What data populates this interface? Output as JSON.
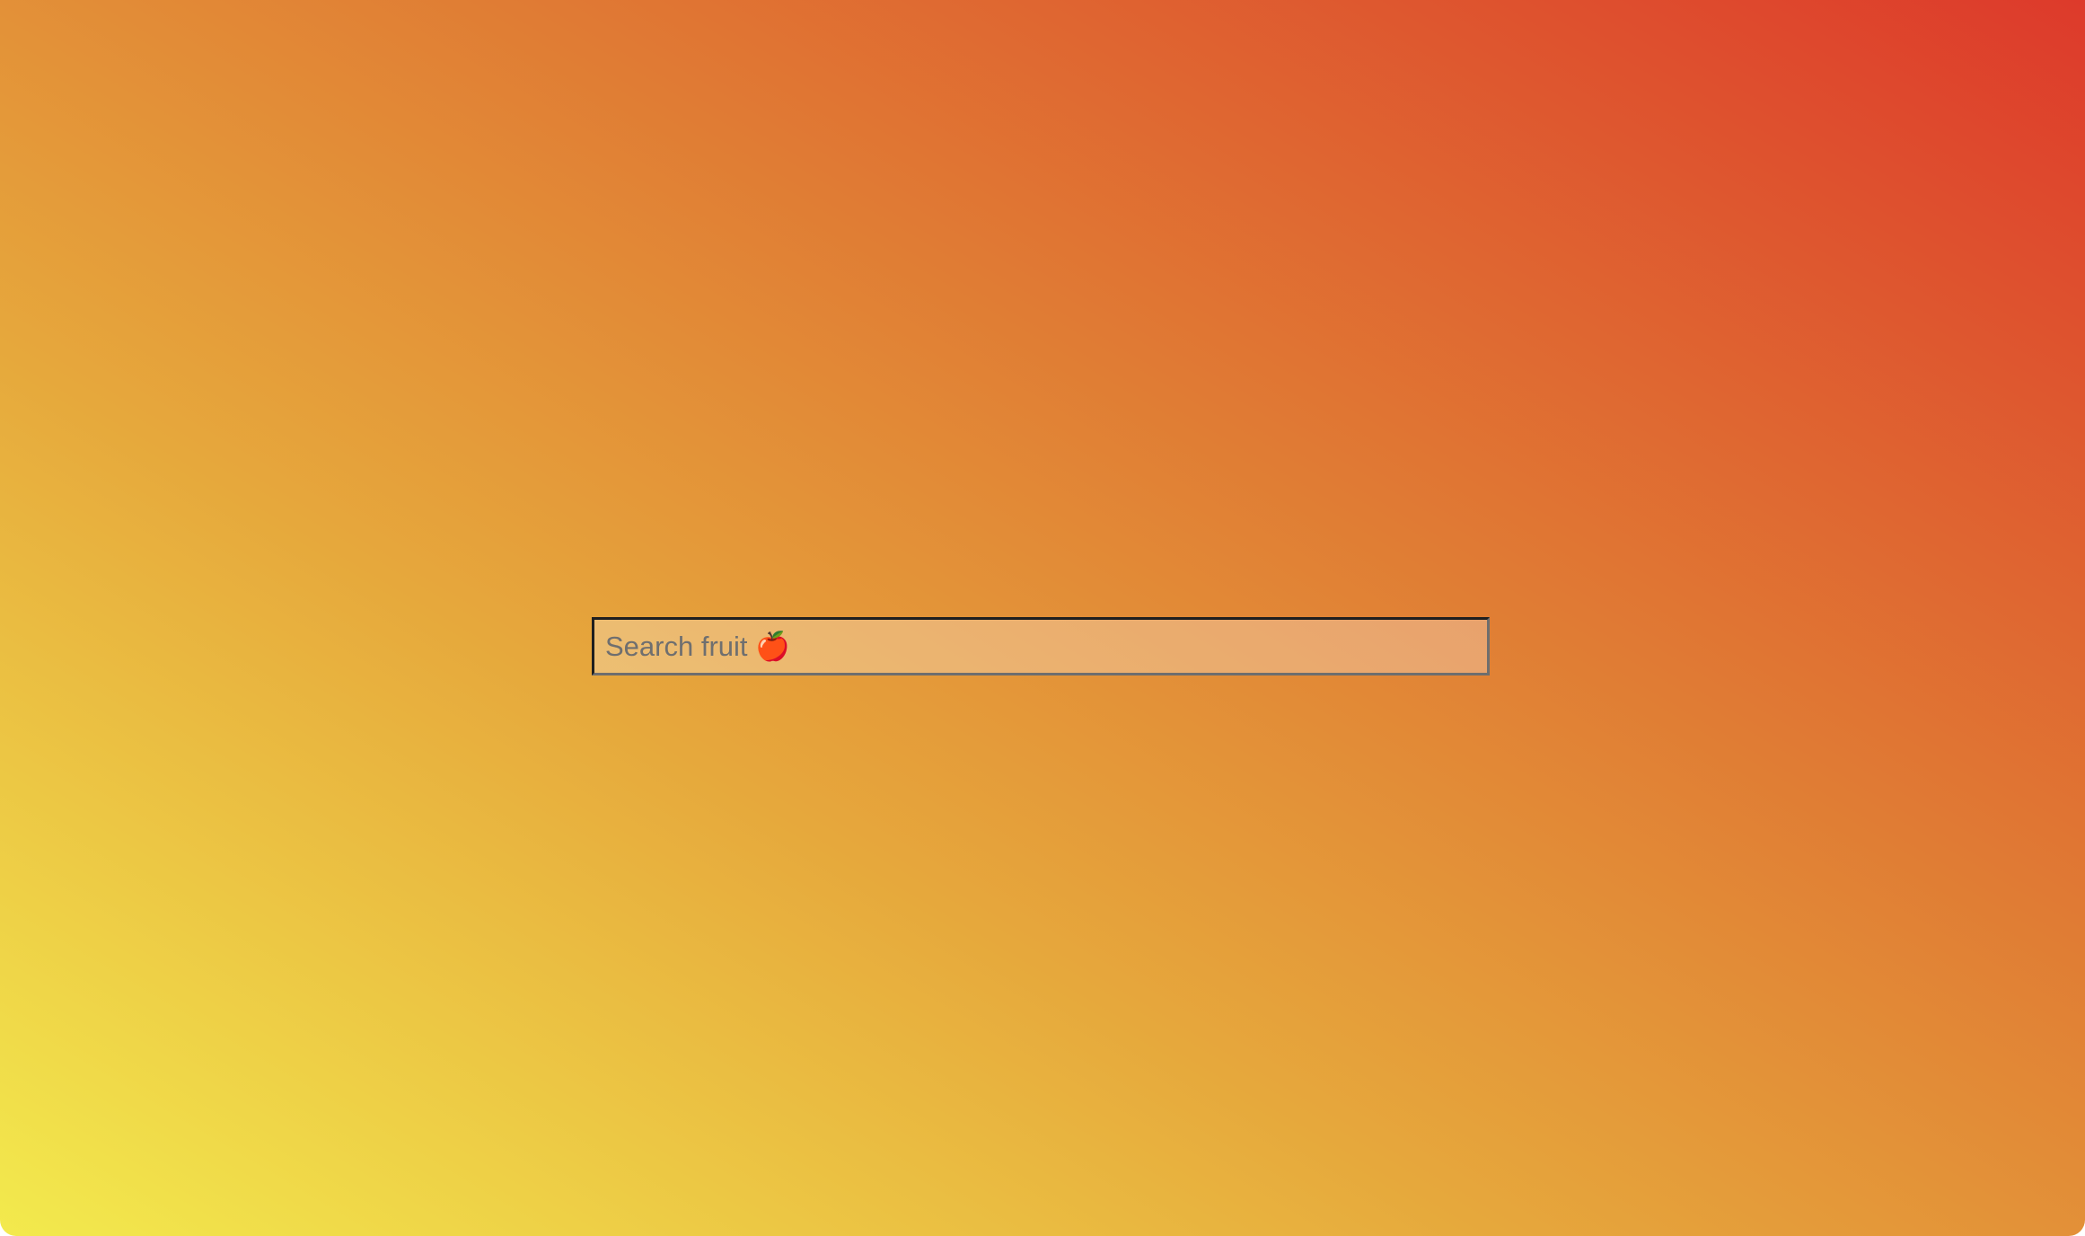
{
  "search": {
    "placeholder": "Search fruit 🍎",
    "value": ""
  },
  "colors": {
    "gradient_bottom_left": "#f3ea4d",
    "gradient_middle": "#e6a83c",
    "gradient_upper_middle": "#e07c34",
    "gradient_top_right": "#dd3a2b",
    "input_border_dark": "#1f1f1f",
    "input_border_light": "#6e6e6e",
    "placeholder_text": "#6f6f6f"
  }
}
